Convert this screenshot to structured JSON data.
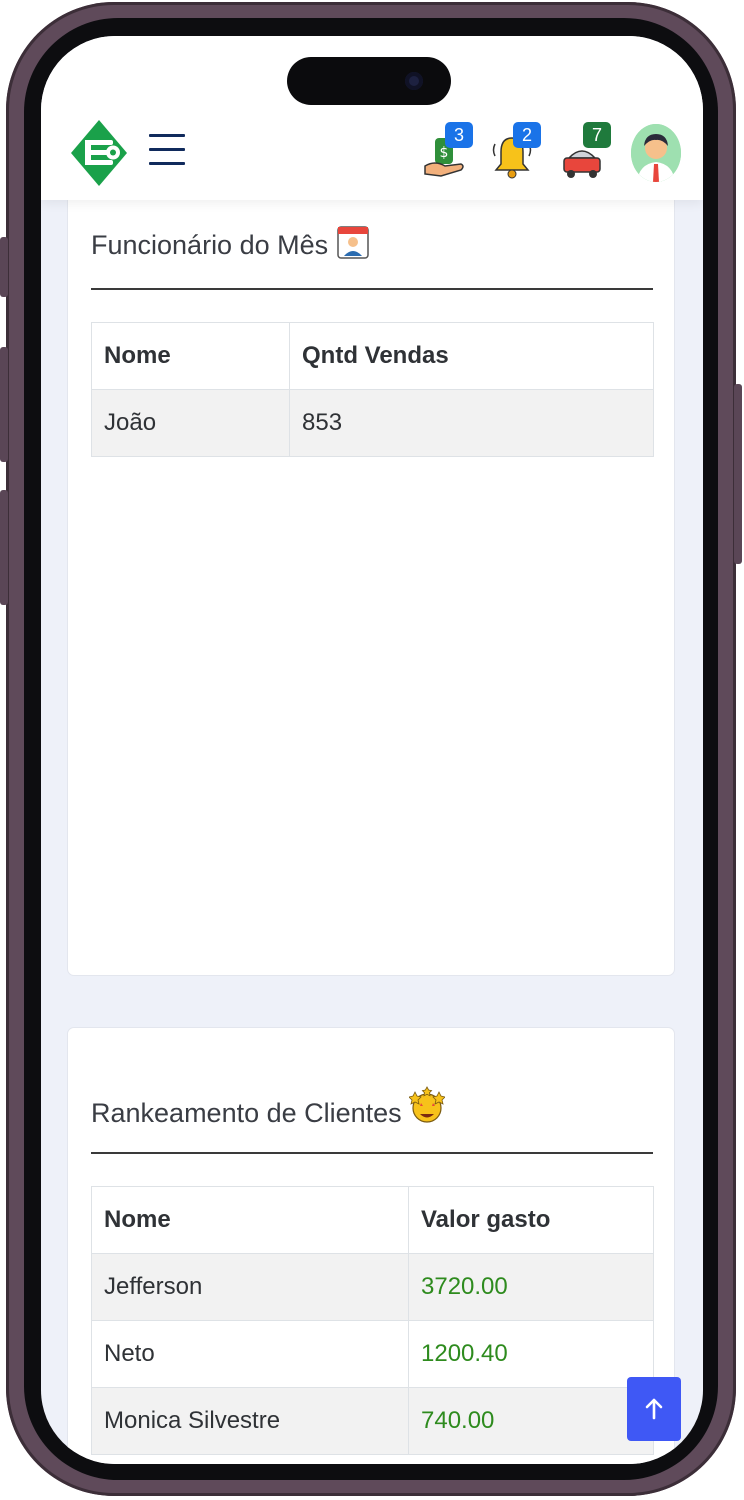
{
  "header": {
    "badges": {
      "sales": "3",
      "notifications": "2",
      "orders": "7"
    },
    "colors": {
      "badge_blue": "#1a73e8",
      "badge_green": "#1f7a3c",
      "logo_green": "#1aa14a"
    },
    "icons": [
      "logo-icon",
      "menu-icon",
      "money-hand-icon",
      "bell-icon",
      "delivery-icon",
      "user-avatar-icon"
    ]
  },
  "employee_card": {
    "title": "Funcionário do Mês",
    "title_icon": "calendar-employee-icon",
    "columns": [
      "Nome",
      "Qntd Vendas"
    ],
    "rows": [
      {
        "name": "João",
        "value": "853"
      }
    ]
  },
  "clients_card": {
    "title": "Rankeamento de Clientes",
    "title_icon": "star-struck-icon",
    "columns": [
      "Nome",
      "Valor gasto"
    ],
    "rows": [
      {
        "name": "Jefferson",
        "value": "3720.00"
      },
      {
        "name": "Neto",
        "value": "1200.40"
      },
      {
        "name": "Monica Silvestre",
        "value": "740.00"
      }
    ],
    "value_color": "#2e8b1e"
  },
  "scroll_top": {
    "icon": "arrow-up-icon",
    "color": "#3f58f5"
  }
}
